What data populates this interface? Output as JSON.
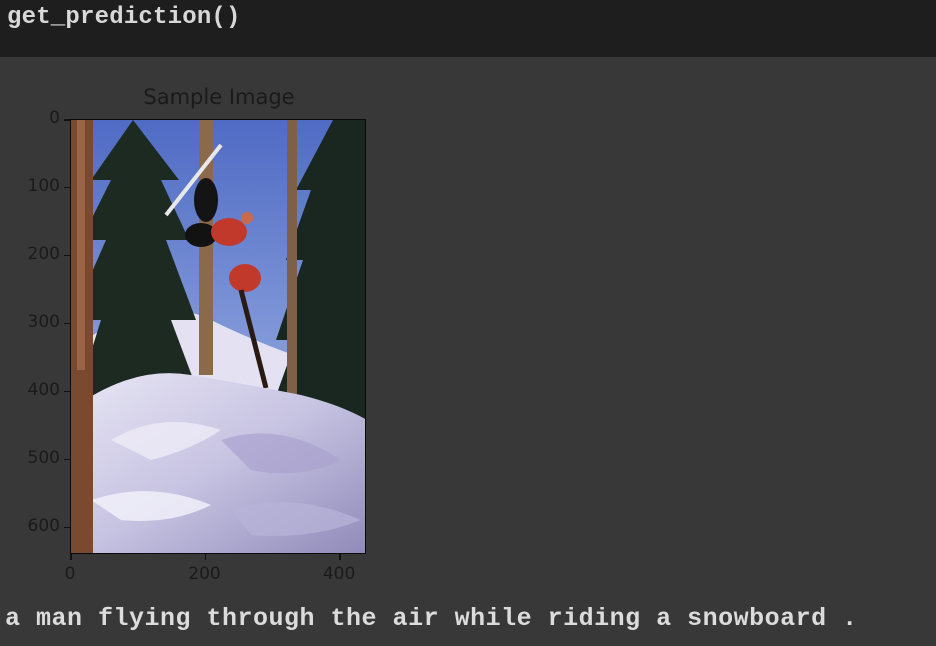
{
  "code_cell": {
    "source": "get_prediction()"
  },
  "plot": {
    "title": "Sample Image",
    "image_description_icon": "snowboarder-photo-icon",
    "x_ticks": [
      "0",
      "200",
      "400"
    ],
    "y_ticks": [
      "0",
      "100",
      "200",
      "300",
      "400",
      "500",
      "600"
    ]
  },
  "output": {
    "caption": "a man flying through the air while riding a snowboard ."
  },
  "chart_data": {
    "type": "image",
    "title": "Sample Image",
    "xlabel": "",
    "ylabel": "",
    "xlim": [
      0,
      440
    ],
    "ylim": [
      640,
      0
    ],
    "x_ticks": [
      0,
      200,
      400
    ],
    "y_ticks": [
      0,
      100,
      200,
      300,
      400,
      500,
      600
    ]
  }
}
